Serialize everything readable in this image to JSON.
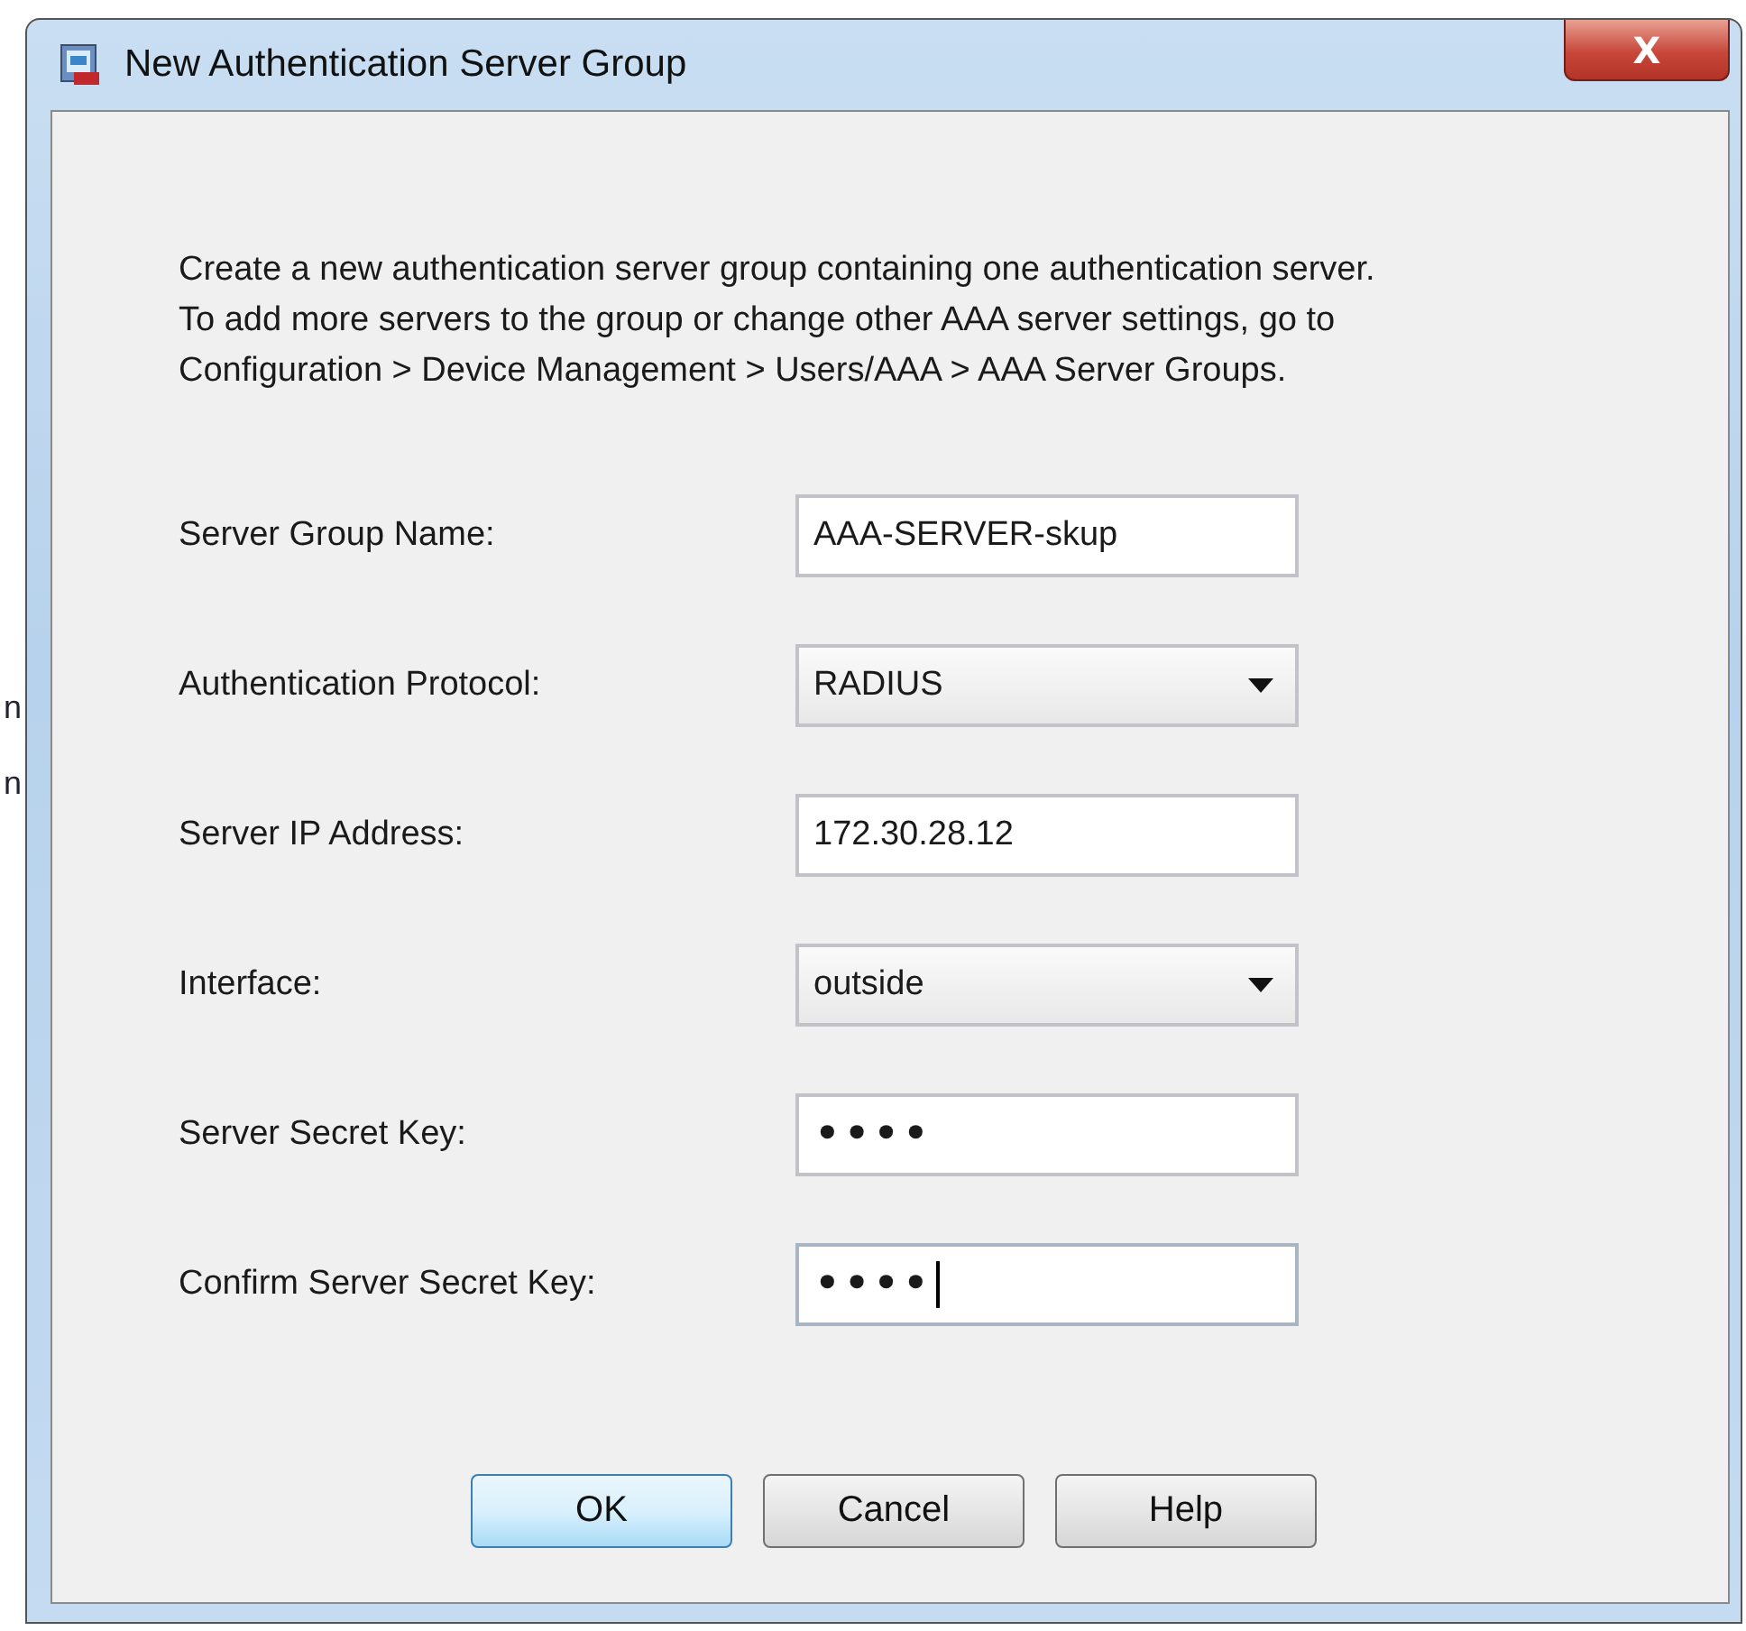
{
  "background_fragments": [
    "n",
    "n"
  ],
  "window": {
    "title": "New Authentication Server Group",
    "close": "X"
  },
  "description": "Create a new authentication server group containing one authentication server.\nTo add more servers to the group or change other AAA server settings, go to\nConfiguration > Device Management > Users/AAA > AAA Server Groups.",
  "fields": [
    {
      "label": "Server Group Name:",
      "kind": "text",
      "value": "AAA-SERVER-skup",
      "focused": false
    },
    {
      "label": "Authentication Protocol:",
      "kind": "select",
      "value": "RADIUS",
      "focused": false
    },
    {
      "label": "Server IP Address:",
      "kind": "text",
      "value": "172.30.28.12",
      "focused": false
    },
    {
      "label": "Interface:",
      "kind": "select",
      "value": "outside",
      "focused": false
    },
    {
      "label": "Server Secret Key:",
      "kind": "password",
      "value": "••••",
      "focused": false
    },
    {
      "label": "Confirm Server Secret Key:",
      "kind": "password",
      "value": "••••",
      "focused": true
    }
  ],
  "buttons": [
    {
      "label": "OK",
      "default": true
    },
    {
      "label": "Cancel",
      "default": false
    },
    {
      "label": "Help",
      "default": false
    }
  ]
}
